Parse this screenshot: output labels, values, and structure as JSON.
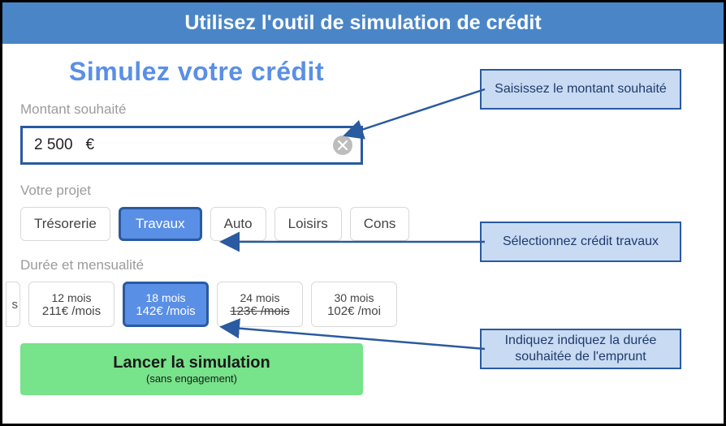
{
  "header": {
    "title": "Utilisez l'outil de simulation de crédit"
  },
  "sim": {
    "title": "Simulez votre crédit",
    "amount_label": "Montant souhaité",
    "amount_value": "2 500",
    "amount_currency": "€",
    "project_label": "Votre projet",
    "projects": {
      "tresorerie": "Trésorerie",
      "travaux": "Travaux",
      "auto": "Auto",
      "loisirs": "Loisirs",
      "cons": "Cons"
    },
    "duration_label": "Durée et mensualité",
    "durations": {
      "edge_left": "s",
      "d12_m": "12 mois",
      "d12_p": "211€ /mois",
      "d18_m": "18 mois",
      "d18_p": "142€ /mois",
      "d24_m": "24 mois",
      "d24_p": "123€ /mois",
      "d30_m": "30 mois",
      "d30_p": "102€ /moi"
    },
    "launch_main": "Lancer la simulation",
    "launch_sub": "(sans engagement)"
  },
  "callouts": {
    "c1": "Saisissez le montant souhaité",
    "c2": "Sélectionnez crédit travaux",
    "c3": "Indiquez indiquez la durée souhaitée de l'emprunt"
  }
}
